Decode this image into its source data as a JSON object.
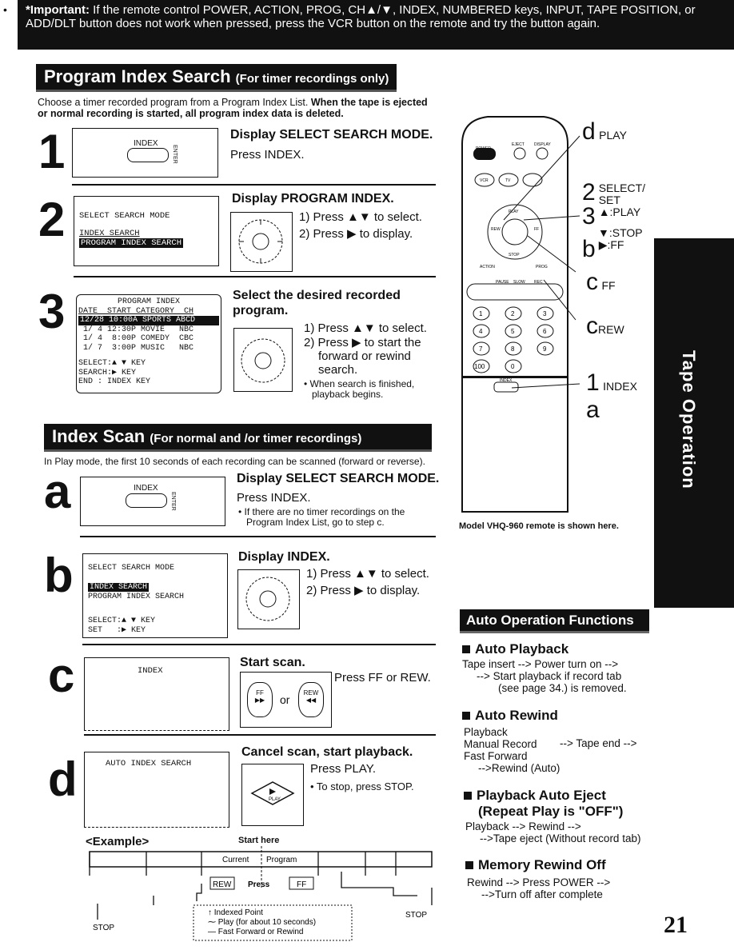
{
  "important": {
    "bullet": "•",
    "label": "*Important:",
    "text": "If the remote control POWER, ACTION, PROG, CH▲/▼, INDEX, NUMBERED keys, INPUT, TAPE POSITION, or ADD/DLT button does not work when pressed, press the VCR button on the remote and try the button again."
  },
  "program_index": {
    "heading": "Program Index Search",
    "heading_sub": "(For timer recordings only)",
    "intro_plain": "Choose a timer recorded program from a Program Index List.",
    "intro_bold": "When the tape is ejected or normal recording is started, all program index data is deleted.",
    "steps": [
      {
        "num": "1",
        "title": "Display SELECT SEARCH MODE.",
        "lines": [
          "Press INDEX."
        ]
      },
      {
        "num": "2",
        "title": "Display PROGRAM INDEX.",
        "lines": [
          "1) Press ▲▼ to select.",
          "2) Press ▶ to display."
        ]
      },
      {
        "num": "3",
        "title": "Select the desired recorded program.",
        "lines": [
          "1) Press ▲▼ to select.",
          "2) Press ▶ to start the forward or rewind search."
        ],
        "note": "• When search is finished, playback begins."
      }
    ],
    "screen2": {
      "line1": "SELECT SEARCH MODE",
      "line2": "INDEX SEARCH",
      "line3": "PROGRAM INDEX SEARCH"
    },
    "screen3": {
      "title": "PROGRAM INDEX",
      "header": "DATE  START CATEGORY  CH",
      "rows": [
        "12/28 10:00A SPORTS ABCD",
        " 1/ 4 12:30P MOVIE   NBC",
        " 1/ 4  8:00P COMEDY  CBC",
        " 1/ 7  3:00P MUSIC   NBC"
      ],
      "keys": [
        "SELECT:▲ ▼ KEY",
        "SEARCH:▶ KEY",
        "END   : INDEX KEY"
      ]
    }
  },
  "index_scan": {
    "heading": "Index Scan",
    "heading_sub": "(For normal and /or timer recordings)",
    "intro": "In Play mode, the first 10 seconds of each recording can be scanned (forward or reverse).",
    "steps": [
      {
        "num": "a",
        "title": "Display SELECT SEARCH MODE.",
        "lines": [
          "Press INDEX."
        ],
        "note": "• If there are no timer recordings on the Program Index List, go to step c."
      },
      {
        "num": "b",
        "title": "Display INDEX.",
        "lines": [
          "1) Press ▲▼ to select.",
          "2) Press ▶ to display."
        ]
      },
      {
        "num": "c",
        "title": "Start scan.",
        "lines": [
          "Press FF or REW."
        ]
      },
      {
        "num": "d",
        "title": "Cancel scan, start playback.",
        "lines": [
          "Press PLAY."
        ],
        "note": "• To stop, press STOP."
      }
    ],
    "screen_b": {
      "line1": "SELECT SEARCH MODE",
      "line2": "INDEX SEARCH",
      "line3": "PROGRAM INDEX SEARCH",
      "line4": "SELECT:▲ ▼ KEY",
      "line5": "SET   :▶ KEY"
    },
    "screen_c": "INDEX",
    "screen_d": "AUTO INDEX SEARCH",
    "index_key": "INDEX",
    "enter_key": "ENTER",
    "ff_key": "FF",
    "rew_key": "REW",
    "or": "or",
    "play_key": "PLAY"
  },
  "example": {
    "label": "<Example>",
    "start_here": "Start here",
    "current": "Current",
    "program": "Program",
    "rew": "REW",
    "press": "Press",
    "ff": "FF",
    "stop": "STOP",
    "legend": [
      "Indexed Point",
      "Play (for about 10 seconds)",
      "Fast Forward or Rewind"
    ]
  },
  "remote": {
    "keys": {
      "power": "POWER",
      "eject": "EJECT",
      "display": "DISPLAY",
      "vcr": "VCR",
      "tv": "TV",
      "play": "PLAY",
      "rew": "REW",
      "ff": "FF",
      "stop": "STOP",
      "action": "ACTION",
      "prog": "PROG",
      "pause": "PAUSE",
      "slow": "SLOW",
      "rec": "REC",
      "index": "INDEX",
      "numbers": [
        "1",
        "2",
        "3",
        "4",
        "5",
        "6",
        "7",
        "8",
        "9",
        "100",
        "0"
      ]
    },
    "callouts": [
      {
        "num": "d",
        "label": "PLAY"
      },
      {
        "num": "2",
        "label": "SELECT/ SET"
      },
      {
        "num": "3",
        "label": "▲:PLAY"
      },
      {
        "num": "",
        "label": "▼:STOP"
      },
      {
        "num": "b",
        "label": "▶:FF"
      },
      {
        "num": "c",
        "label": "FF"
      },
      {
        "num": "c",
        "label": "REW"
      },
      {
        "num": "1",
        "label": "INDEX"
      },
      {
        "num": "a",
        "label": ""
      }
    ],
    "caption": "Model VHQ-960 remote is shown here."
  },
  "side_tab": "Tape Operation",
  "auto_ops": {
    "heading": "Auto Operation Functions",
    "sections": [
      {
        "title": "Auto Playback",
        "lines": [
          "Tape insert --> Power turn on -->",
          "--> Start playback if record tab",
          "(see page 34.) is removed."
        ]
      },
      {
        "title": "Auto Rewind",
        "lines": [
          "Playback",
          "Manual Record",
          "Fast Forward",
          "-->Rewind (Auto)"
        ],
        "result": "--> Tape end -->"
      },
      {
        "title": "Playback Auto Eject (Repeat Play is \"OFF\")",
        "lines": [
          "Playback --> Rewind -->",
          "-->Tape eject (Without record tab)"
        ]
      },
      {
        "title": "Memory Rewind Off",
        "lines": [
          "Rewind --> Press POWER -->",
          "-->Turn off after complete"
        ]
      }
    ]
  },
  "page_number": "21",
  "colors": {
    "ink": "#111111",
    "paper": "#ffffff"
  }
}
